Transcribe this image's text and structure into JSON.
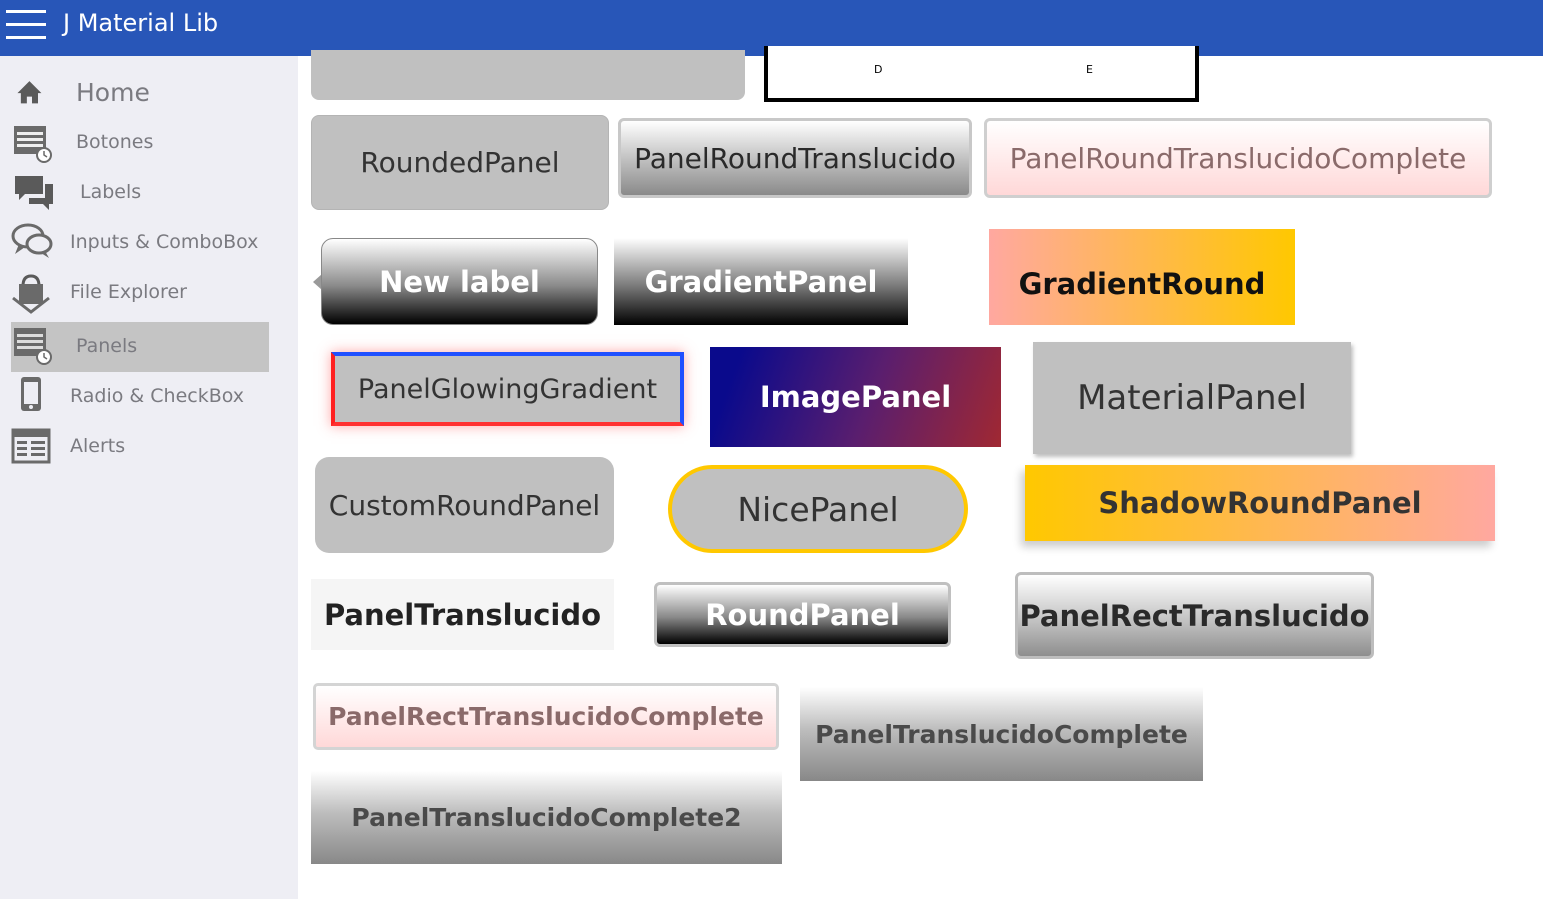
{
  "app": {
    "title": "J Material Lib"
  },
  "sidebar": {
    "items": [
      {
        "label": "Home",
        "icon": "home-icon",
        "active": false
      },
      {
        "label": "Botones",
        "icon": "list-clock-icon",
        "active": false
      },
      {
        "label": "Labels",
        "icon": "chat-bubbles-icon",
        "active": false
      },
      {
        "label": "Inputs & ComboBox",
        "icon": "speech-bubbles-icon",
        "active": false
      },
      {
        "label": "File Explorer",
        "icon": "shopping-bag-icon",
        "active": false
      },
      {
        "label": "Panels",
        "icon": "list-clock-icon",
        "active": true
      },
      {
        "label": "Radio & CheckBox",
        "icon": "phone-icon",
        "active": false
      },
      {
        "label": "Alerts",
        "icon": "newspaper-icon",
        "active": false
      }
    ]
  },
  "panels": {
    "top_box_labels": [
      "D",
      "E"
    ],
    "rounded_panel": "RoundedPanel",
    "panel_round_translucido": "PanelRoundTranslucido",
    "panel_round_translucido_complete": "PanelRoundTranslucidoComplete",
    "new_label": "New label",
    "gradient_panel": "GradientPanel",
    "gradient_round": "GradientRound",
    "panel_glowing_gradient": "PanelGlowingGradient",
    "image_panel": "ImagePanel",
    "material_panel": "MaterialPanel",
    "custom_round_panel": "CustomRoundPanel",
    "nice_panel": "NicePanel",
    "shadow_round_panel": "ShadowRoundPanel",
    "panel_translucido": "PanelTranslucido",
    "round_panel": "RoundPanel",
    "panel_rect_translucido": "PanelRectTranslucido",
    "panel_rect_translucido_complete": "PanelRectTranslucidoComplete",
    "panel_translucido_complete": "PanelTranslucidoComplete",
    "panel_translucido_complete2": "PanelTranslucidoComplete2"
  },
  "colors": {
    "topbar": "#2856b8",
    "sidebar_bg": "#eeeef4",
    "sidebar_active": "#c4c4c4",
    "panel_gray": "#c0c0c0",
    "accent_yellow": "#ffc800",
    "accent_pink": "#ffaaa5"
  }
}
